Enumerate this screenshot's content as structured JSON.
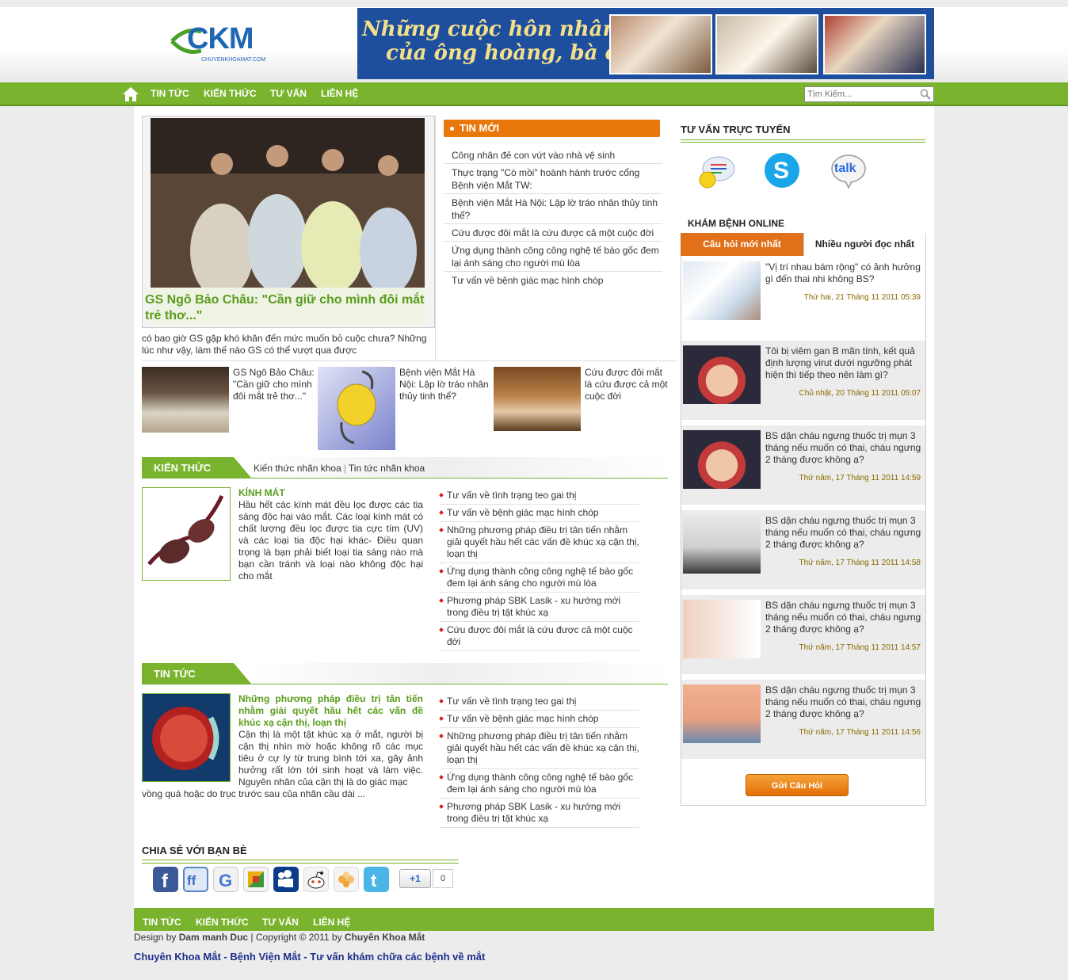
{
  "header": {
    "logo_text": "CKM",
    "logo_sub": "CHUYENKHOAMAT.COM",
    "banner_line1": "Những cuộc hôn nhân u ám",
    "banner_line2": "của ông hoàng, bà chúa"
  },
  "nav": {
    "items": [
      "TIN TỨC",
      "KIẾN THỨC",
      "TƯ VẤN",
      "LIÊN HỆ"
    ],
    "search_placeholder": "Tìm Kiếm..."
  },
  "featured": {
    "title": "GS Ngô Bảo Châu: \"Cần giữ cho mình đôi mắt trẻ thơ...\"",
    "description": "có bao giờ GS gặp khó khăn đến mức muốn bỏ cuộc chưa? Những lúc như vậy, làm thế nào GS có thể vượt qua được"
  },
  "tin_moi": {
    "title": "TIN MỚI",
    "items": [
      "Công nhân đẻ con vứt vào nhà vệ sinh",
      "Thực trạng \"Cò mồi\" hoành hành trước cổng Bệnh viện Mắt TW:",
      "Bệnh viện Mắt Hà Nội: Lập lờ tráo nhân thủy tinh thể?",
      "Cứu được đôi mắt là cứu được cả một cuộc đời",
      "Ứng dụng thành công công nghệ tế bào gốc đem lại ánh sáng cho người mù lòa",
      "Tư vấn về bệnh giác mạc hình chóp"
    ]
  },
  "thumbs": [
    {
      "text": "GS Ngô Bảo Châu: \"Cần giữ cho mình đôi mắt trẻ thơ...\""
    },
    {
      "text": "Bệnh viện Mắt Hà Nội: Lập lờ tráo nhân thủy tinh thể?"
    },
    {
      "text": "Cứu được đôi mắt là cứu được cả một cuộc đời"
    }
  ],
  "kien_thuc": {
    "title": "KIẾN THỨC",
    "sublink1": "Kiến thức nhãn khoa",
    "separator": "|",
    "sublink2": "Tin tức nhãn khoa",
    "article_title": "KÍNH MÁT",
    "article_body": "Hầu hết các kính mát đều lọc được các tia sáng độc hại vào mắt. Các loại kính mát có chất lượng đều lọc được tia cực tím (UV) và các loại tia độc hại khác- Điều quan trọng là bạn phải biết loại tia sáng nào mà bạn cần tránh và loại nào không độc hại cho mắt",
    "links": [
      "Tư vấn về tình trạng teo gai thị",
      "Tư vấn về bệnh giác mạc hình chóp",
      "Những phương pháp điều trị tân tiến nhằm giải quyết hầu hết các vấn đề khúc xạ cận thị, loạn thị",
      "Ứng dụng thành công công nghệ tế bào gốc đem lại ánh sáng cho người mù lòa",
      "Phương pháp SBK Lasik - xu hướng mới trong điều trị tật khúc xạ",
      "Cứu được đôi mắt là cứu được cả một cuộc đời"
    ]
  },
  "tin_tuc": {
    "title": "TIN TỨC",
    "article_title": "Những phương pháp điều trị tân tiến nhằm giải quyết hầu hết các vấn đề khúc xạ cận thị, loạn thị",
    "article_body": "Cận thị là một tật khúc xạ ở mắt, người bị cận thị nhìn mờ hoặc không rõ các mục tiêu ở cự ly từ trung bình tới xa, gây ảnh hưởng rất lớn tới sinh hoạt và làm việc. Nguyên nhân của cận thị là do giác mạc",
    "article_body_tail": "vồng quá hoặc do trục trước sau của nhãn cầu dài ...",
    "links": [
      "Tư vấn về tình trạng teo gai thị",
      "Tư vấn về bệnh giác mạc hình chóp",
      "Những phương pháp điều trị tân tiến nhằm giải quyết hầu hết các vấn đề khúc xạ cận thị, loạn thị",
      "Ứng dụng thành công công nghệ tế bào gốc đem lại ánh sáng cho người mù lòa",
      "Phương pháp SBK Lasik - xu hướng mới trong điều trị tật khúc xạ"
    ]
  },
  "share": {
    "title": "CHIA SẺ VỚI BẠN BÈ",
    "icons": [
      "facebook-icon",
      "friendfeed-icon",
      "google-icon",
      "google-buzz-icon",
      "myspace-icon",
      "reddit-icon",
      "flickr-icon",
      "twitter-icon"
    ],
    "plusone_label": "+1",
    "plusone_count": "0"
  },
  "tu_van": {
    "title": "TƯ VẤN TRỰC TUYẾN",
    "icons": [
      "yahoo-messenger-icon",
      "skype-icon",
      "google-talk-icon"
    ],
    "talk_label": "talk"
  },
  "kham_benh": {
    "title": "KHÁM BỆNH ONLINE",
    "tab_new": "Câu hỏi mới nhất",
    "tab_read": "Nhiều người đọc nhất",
    "questions": [
      {
        "text": "\"Vị trí nhau bám rộng\" có ảnh hưởng gì đến thai nhi không BS?",
        "date": "Thứ hai, 21 Tháng 11 2011 05:39"
      },
      {
        "text": "Tôi bị viêm gan B mãn tính, kết quả định lượng virut dưới ngưỡng phát hiện thì tiếp theo nên làm gì?",
        "date": "Chủ nhật, 20 Tháng 11 2011 05:07"
      },
      {
        "text": "BS dặn cháu ngưng thuốc trị mụn 3 tháng nếu muốn có thai, cháu ngưng 2 tháng được không ạ?",
        "date": "Thứ năm, 17 Tháng 11 2011 14:59"
      },
      {
        "text": "BS dặn cháu ngưng thuốc trị mụn 3 tháng nếu muốn có thai, cháu ngưng 2 tháng được không ạ?",
        "date": "Thứ năm, 17 Tháng 11 2011 14:58"
      },
      {
        "text": "BS dặn cháu ngưng thuốc trị mụn 3 tháng nếu muốn có thai, cháu ngưng 2 tháng được không ạ?",
        "date": "Thứ năm, 17 Tháng 11 2011 14:57"
      },
      {
        "text": "BS dặn cháu ngưng thuốc trị mụn 3 tháng nếu muốn có thai, cháu ngưng 2 tháng được không ạ?",
        "date": "Thứ năm, 17 Tháng 11 2011 14:56"
      }
    ],
    "ask_button": "Gửi Câu Hỏi"
  },
  "footer": {
    "nav": [
      "TIN TỨC",
      "KIẾN THỨC",
      "TƯ VẤN",
      "LIÊN HỆ"
    ],
    "design_by_label": "Design by",
    "designer": "Dam manh Duc",
    "copyright": "| Copyright © 2011 by",
    "owner": "Chuyên Khoa Mắt",
    "tagline": "Chuyên Khoa Mắt - Bệnh Viện Mắt - Tư vấn khám chữa các bệnh về mắt"
  },
  "colors": {
    "nav_green": "#7ab42e",
    "accent_orange": "#e8770c",
    "headline_green": "#5a9c1c",
    "tagline_blue": "#1d2f8c"
  }
}
